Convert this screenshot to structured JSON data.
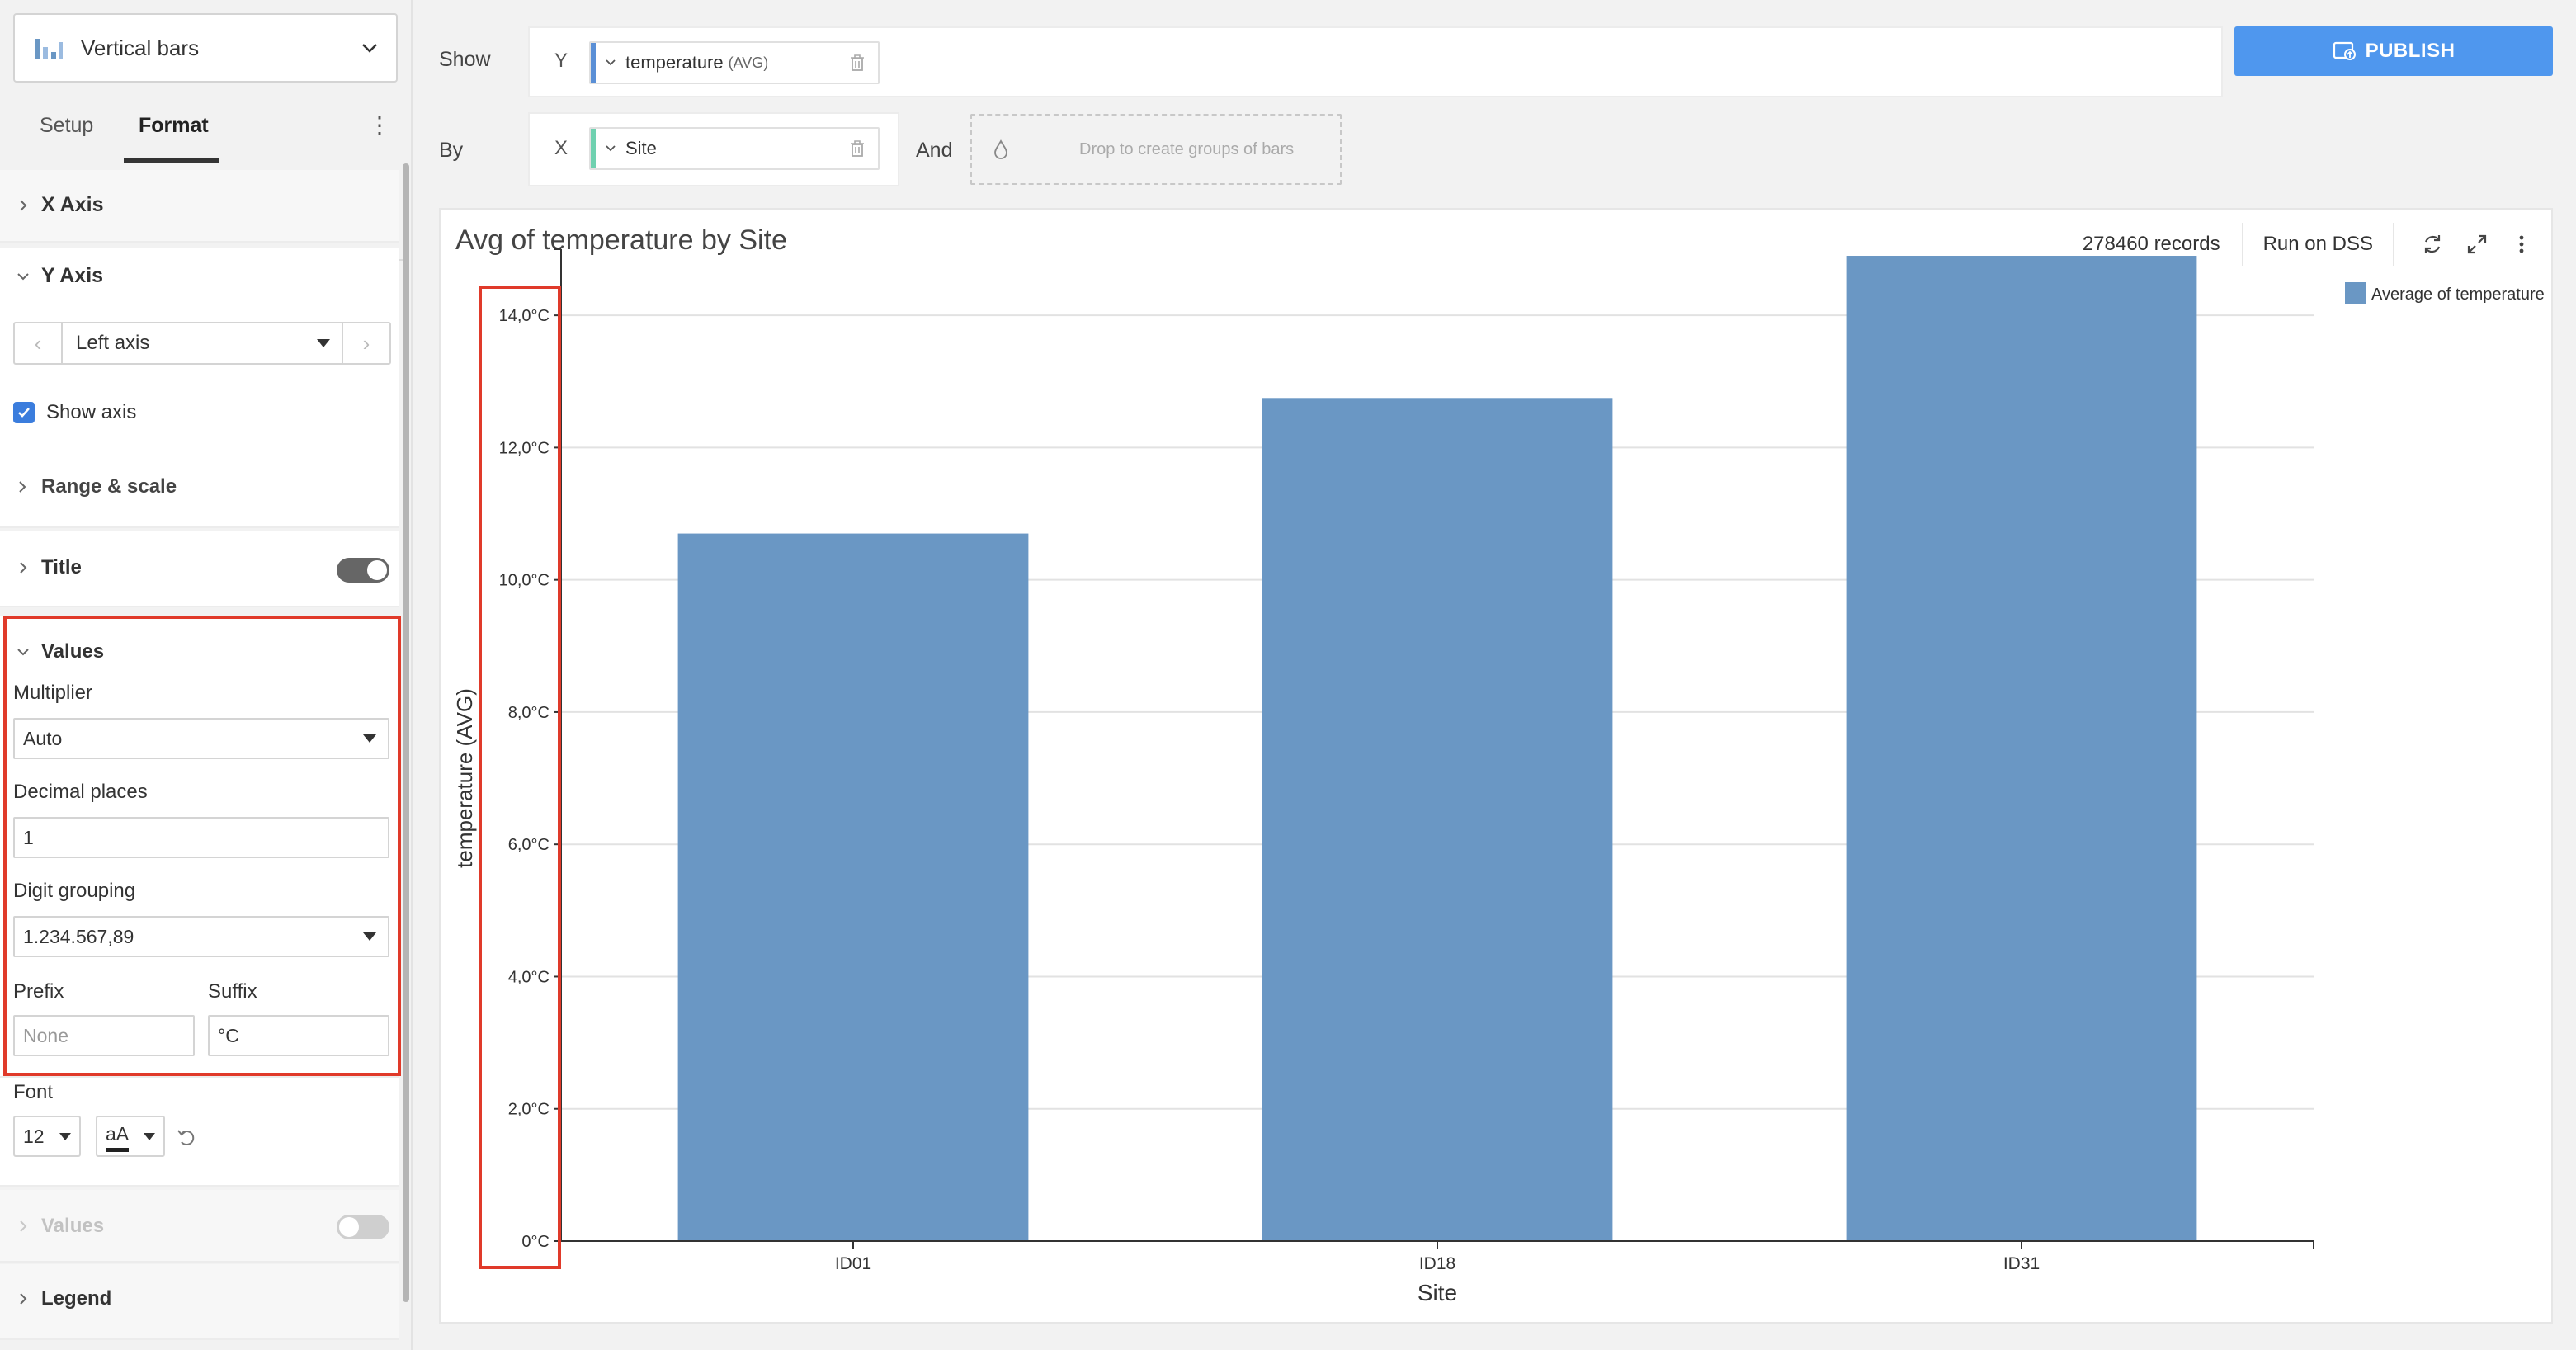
{
  "sidebar": {
    "chart_type_label": "Vertical bars",
    "tabs": [
      {
        "label": "Setup"
      },
      {
        "label": "Format"
      }
    ],
    "sections": {
      "x_axis": "X Axis",
      "y_axis": "Y Axis",
      "left_axis": "Left axis",
      "show_axis": "Show axis",
      "range_scale": "Range & scale",
      "title": "Title",
      "values": "Values",
      "values_section_2": "Values",
      "legend": "Legend"
    },
    "values_format": {
      "multiplier_label": "Multiplier",
      "multiplier_value": "Auto",
      "decimal_places_label": "Decimal places",
      "decimal_places_value": "1",
      "digit_grouping_label": "Digit grouping",
      "digit_grouping_value": "1.234.567,89",
      "prefix_label": "Prefix",
      "prefix_placeholder": "None",
      "suffix_label": "Suffix",
      "suffix_value": "°C"
    },
    "font": {
      "label": "Font",
      "size": "12",
      "color_label": "aA"
    }
  },
  "config": {
    "show_label": "Show",
    "by_label": "By",
    "and_label": "And",
    "y_axis_letter": "Y",
    "x_axis_letter": "X",
    "y_measure": "temperature",
    "y_aggregation": "(AVG)",
    "x_dimension": "Site",
    "drop_zone_text": "Drop to create groups of bars",
    "publish_label": "PUBLISH"
  },
  "chart_header": {
    "title": "Avg of temperature by Site",
    "records": "278460 records",
    "run_on": "Run on DSS"
  },
  "icons": [
    "bar-chart-icon",
    "chevron-down-icon",
    "chevron-left-icon",
    "chevron-right-icon",
    "check-icon",
    "reset-icon",
    "trash-icon",
    "drop-icon",
    "publish-icon",
    "refresh-icon",
    "expand-icon",
    "more-vertical-icon"
  ],
  "colors": {
    "bar": "#6a97c4",
    "accent": "#4f97ee",
    "highlight": "#e03a2a"
  },
  "chart_data": {
    "type": "bar",
    "categories": [
      "ID01",
      "ID18",
      "ID31"
    ],
    "series": [
      {
        "name": "Average of temperature",
        "values": [
          10.7,
          12.75,
          14.9
        ]
      }
    ],
    "xlabel": "Site",
    "ylabel": "temperature (AVG)",
    "ylim": [
      0,
      15
    ],
    "yticks": [
      0,
      2,
      4,
      6,
      8,
      10,
      12,
      14
    ],
    "ytick_labels": [
      "0°C",
      "2,0°C",
      "4,0°C",
      "6,0°C",
      "8,0°C",
      "10,0°C",
      "12,0°C",
      "14,0°C"
    ],
    "grid": true,
    "legend_position": "top-right"
  }
}
